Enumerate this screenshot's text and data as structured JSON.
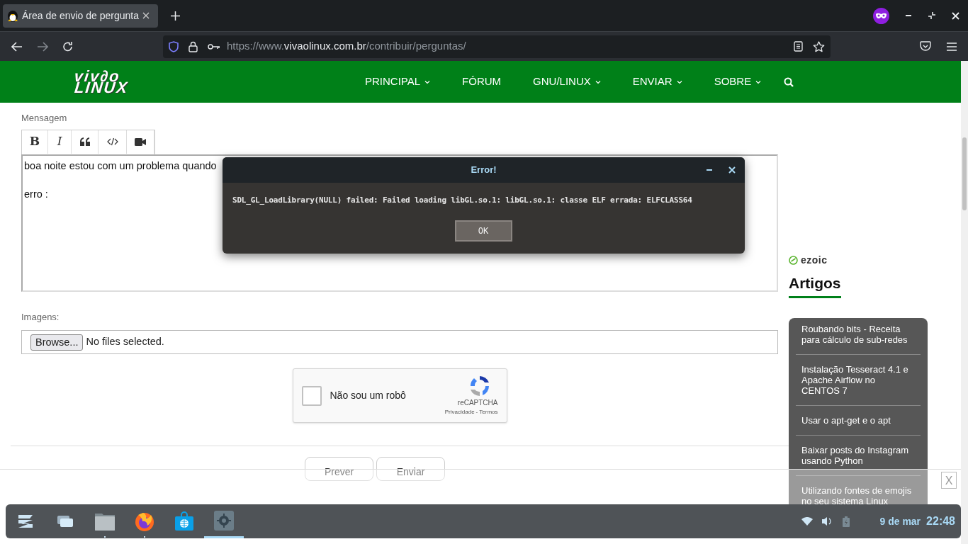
{
  "browser": {
    "tab": {
      "title": "Área de envio de pergunta",
      "selected": true
    },
    "url": {
      "scheme": "https://www.",
      "domain": "vivaolinux.com.br",
      "path": "/contribuir/perguntas/"
    }
  },
  "site": {
    "logo": {
      "top": "viv∂o",
      "bottom": "LINUX"
    },
    "nav": [
      {
        "label": "PRINCIPAL",
        "dropdown": true
      },
      {
        "label": "FÓRUM",
        "dropdown": false
      },
      {
        "label": "GNU/LINUX",
        "dropdown": true
      },
      {
        "label": "ENVIAR",
        "dropdown": true
      },
      {
        "label": "SOBRE",
        "dropdown": true
      }
    ]
  },
  "form": {
    "message_label": "Mensagem",
    "toolbar": [
      {
        "kind": "bold",
        "label": "B"
      },
      {
        "kind": "italic",
        "label": "I"
      },
      {
        "kind": "quote"
      },
      {
        "kind": "code"
      },
      {
        "kind": "video"
      }
    ],
    "message_lines": [
      "boa noite estou com um problema quando",
      "erro :"
    ],
    "images_label": "Imagens:",
    "browse_button": "Browse...",
    "file_status": "No files selected.",
    "captcha": {
      "label": "Não sou um robô",
      "checked": false,
      "brand": "reCAPTCHA",
      "privacy": "Privacidade",
      "separator": "-",
      "terms": "Termos"
    },
    "buttons": [
      "Prever",
      "Enviar"
    ]
  },
  "dialog": {
    "title": "Error!",
    "message": "SDL_GL_LoadLibrary(NULL) failed: Failed loading libGL.so.1: libGL.so.1: classe ELF errada: ELFCLASS64",
    "ok": "OK"
  },
  "sidebar": {
    "ad_brand": "ezoic",
    "heading": "Artigos",
    "articles": [
      "Roubando bits - Receita para cálculo de sub-redes",
      "Instalação Tesseract 4.1 e Apache Airflow no CENTOS 7",
      "Usar o apt-get e o apt",
      "Baixar posts do Instagram usando Python",
      "Utilizando fontes de emojis no seu sistema Linux"
    ]
  },
  "ad_close": "X",
  "taskbar": {
    "apps": [
      {
        "kind": "menu",
        "running": false,
        "selected": false
      },
      {
        "kind": "windows",
        "running": false,
        "selected": false
      },
      {
        "kind": "files",
        "running": true,
        "selected": false
      },
      {
        "kind": "browser",
        "running": true,
        "selected": false
      },
      {
        "kind": "store",
        "running": false,
        "selected": false
      },
      {
        "kind": "settings",
        "running": true,
        "selected": true
      }
    ],
    "date": "9 de mar",
    "time": "22:48"
  }
}
